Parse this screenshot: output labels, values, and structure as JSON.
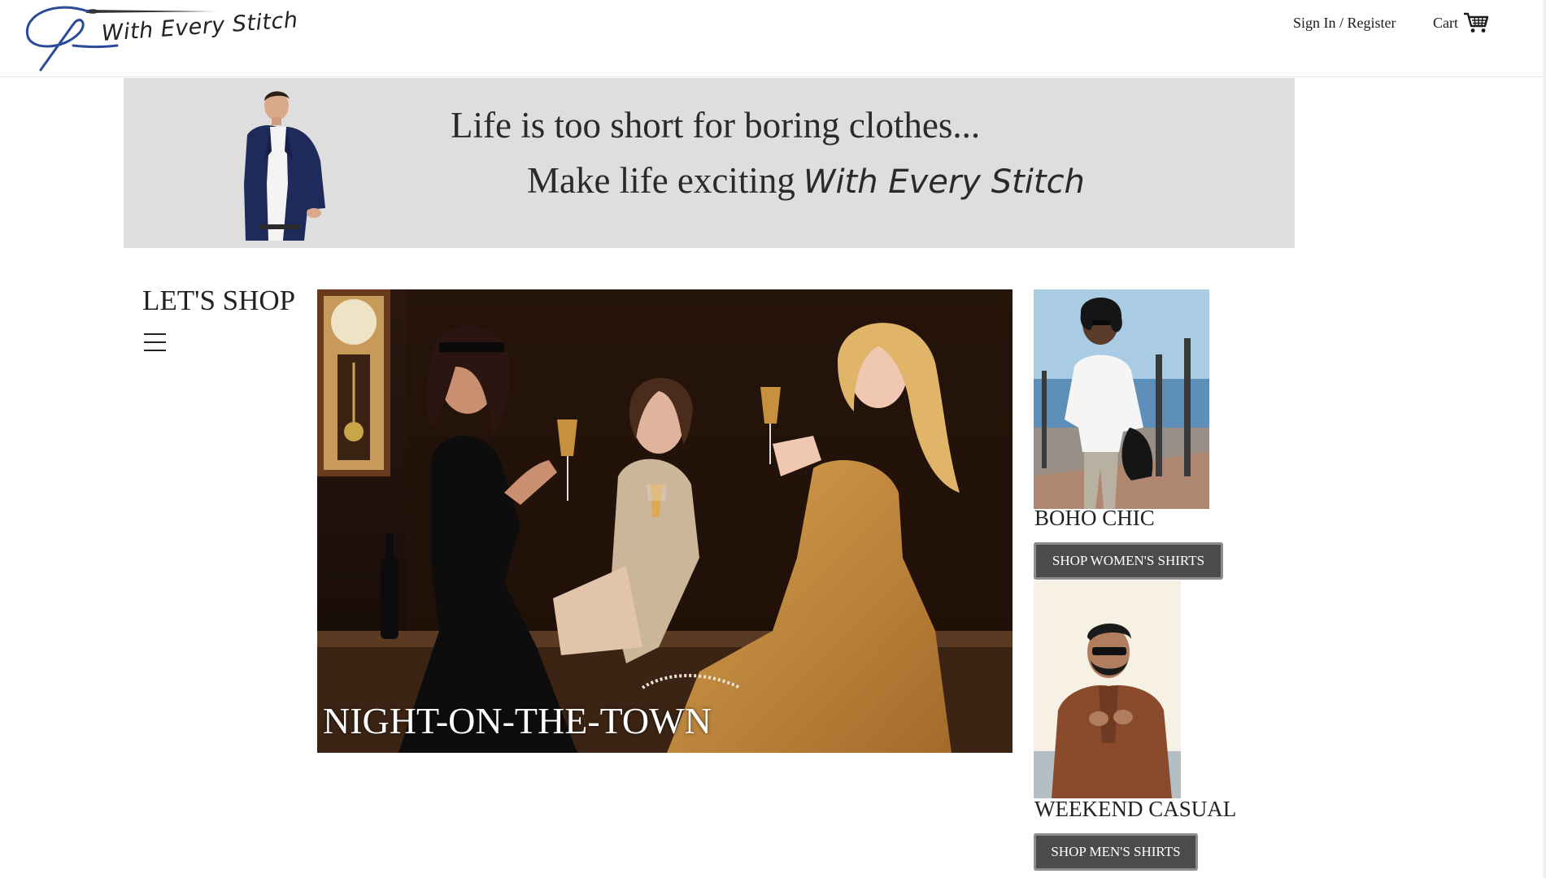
{
  "header": {
    "logo_text": "With Every Stitch",
    "signin_label": "Sign In / Register",
    "cart_label": "Cart"
  },
  "banner": {
    "line1": "Life is too short for boring clothes...",
    "line2_prefix": "Make life exciting",
    "line2_brand": "With Every Stitch"
  },
  "shop": {
    "title": "LET'S SHOP",
    "menu_icon": "hamburger-menu-icon"
  },
  "hero": {
    "caption": "NIGHT-ON-THE-TOWN"
  },
  "cards": [
    {
      "title": "BOHO CHIC",
      "button_label": "SHOP WOMEN'S SHIRTS"
    },
    {
      "title": "WEEKEND CASUAL",
      "button_label": "SHOP MEN'S SHIRTS"
    }
  ],
  "colors": {
    "banner_bg": "#dedede",
    "button_bg": "#4b4b4b",
    "logo_blue": "#2c4a9a"
  }
}
